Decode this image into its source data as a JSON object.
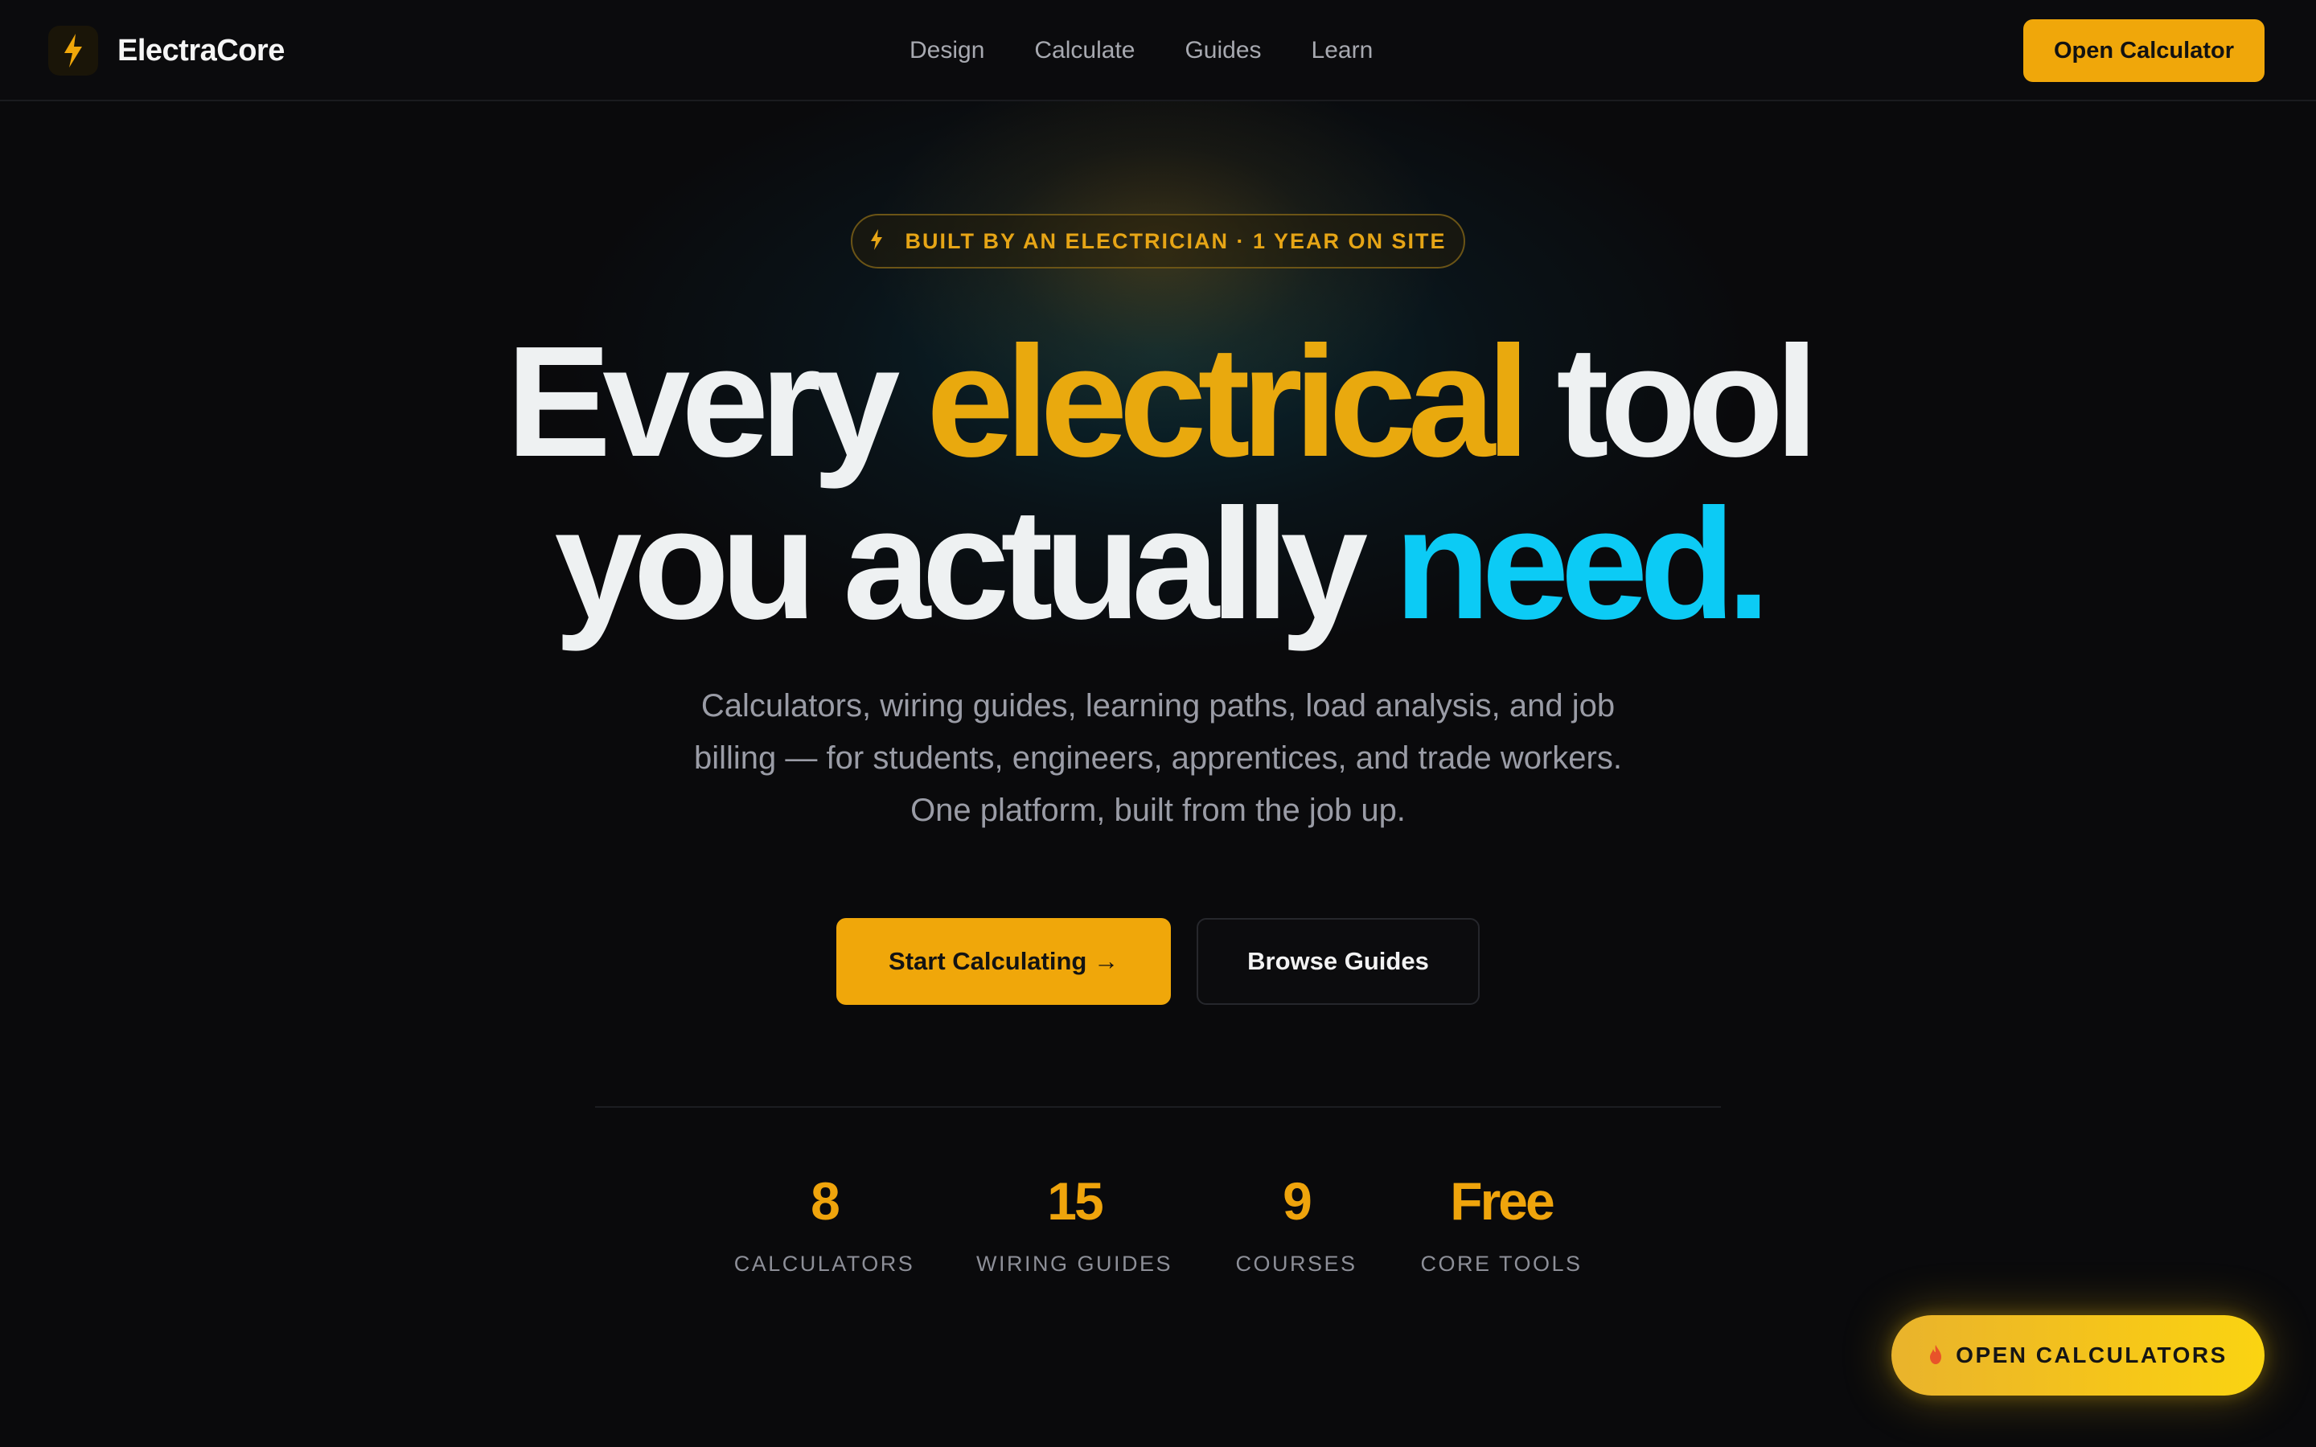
{
  "nav": {
    "brand": "ElectraCore",
    "links": [
      "Design",
      "Calculate",
      "Guides",
      "Learn"
    ],
    "cta": "Open Calculator"
  },
  "hero": {
    "badge_icon": "bolt-icon",
    "badge": "BUILT BY AN ELECTRICIAN · 1 YEAR ON SITE",
    "headline_line1": [
      "Every",
      "electrical",
      "tool"
    ],
    "headline_line2": [
      "you actually",
      "need."
    ],
    "subtitle_lines": [
      "Calculators, wiring guides, learning paths, load analysis, and job",
      "billing — for students, engineers, apprentices, and trade workers.",
      "One platform, built from the job up."
    ],
    "primary_button": "Start Calculating →",
    "secondary_button": "Browse Guides"
  },
  "stats": [
    {
      "value": "8",
      "label": "CALCULATORS"
    },
    {
      "value": "15",
      "label": "WIRING GUIDES"
    },
    {
      "value": "9",
      "label": "COURSES"
    },
    {
      "value": "Free",
      "label": "CORE TOOLS"
    }
  ],
  "floating_cta": {
    "icon": "flame-icon",
    "label": "OPEN CALCULATORS"
  },
  "colors": {
    "background": "#0a0a0c",
    "accent_amber": "#f0a70a",
    "accent_cyan": "#0ccbf5",
    "text_muted": "#9a9ca6"
  }
}
